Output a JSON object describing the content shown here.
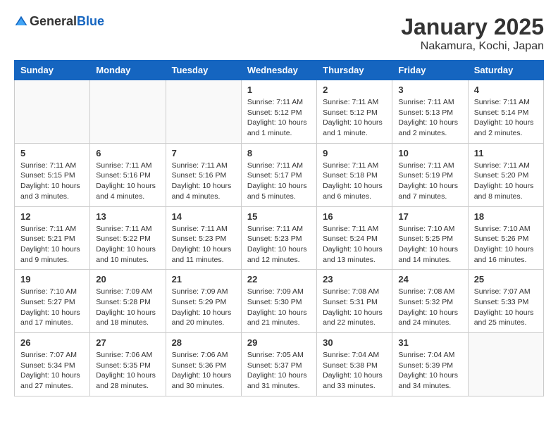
{
  "header": {
    "logo_general": "General",
    "logo_blue": "Blue",
    "title": "January 2025",
    "subtitle": "Nakamura, Kochi, Japan"
  },
  "weekdays": [
    "Sunday",
    "Monday",
    "Tuesday",
    "Wednesday",
    "Thursday",
    "Friday",
    "Saturday"
  ],
  "weeks": [
    [
      {
        "day": "",
        "info": ""
      },
      {
        "day": "",
        "info": ""
      },
      {
        "day": "",
        "info": ""
      },
      {
        "day": "1",
        "info": "Sunrise: 7:11 AM\nSunset: 5:12 PM\nDaylight: 10 hours\nand 1 minute."
      },
      {
        "day": "2",
        "info": "Sunrise: 7:11 AM\nSunset: 5:12 PM\nDaylight: 10 hours\nand 1 minute."
      },
      {
        "day": "3",
        "info": "Sunrise: 7:11 AM\nSunset: 5:13 PM\nDaylight: 10 hours\nand 2 minutes."
      },
      {
        "day": "4",
        "info": "Sunrise: 7:11 AM\nSunset: 5:14 PM\nDaylight: 10 hours\nand 2 minutes."
      }
    ],
    [
      {
        "day": "5",
        "info": "Sunrise: 7:11 AM\nSunset: 5:15 PM\nDaylight: 10 hours\nand 3 minutes."
      },
      {
        "day": "6",
        "info": "Sunrise: 7:11 AM\nSunset: 5:16 PM\nDaylight: 10 hours\nand 4 minutes."
      },
      {
        "day": "7",
        "info": "Sunrise: 7:11 AM\nSunset: 5:16 PM\nDaylight: 10 hours\nand 4 minutes."
      },
      {
        "day": "8",
        "info": "Sunrise: 7:11 AM\nSunset: 5:17 PM\nDaylight: 10 hours\nand 5 minutes."
      },
      {
        "day": "9",
        "info": "Sunrise: 7:11 AM\nSunset: 5:18 PM\nDaylight: 10 hours\nand 6 minutes."
      },
      {
        "day": "10",
        "info": "Sunrise: 7:11 AM\nSunset: 5:19 PM\nDaylight: 10 hours\nand 7 minutes."
      },
      {
        "day": "11",
        "info": "Sunrise: 7:11 AM\nSunset: 5:20 PM\nDaylight: 10 hours\nand 8 minutes."
      }
    ],
    [
      {
        "day": "12",
        "info": "Sunrise: 7:11 AM\nSunset: 5:21 PM\nDaylight: 10 hours\nand 9 minutes."
      },
      {
        "day": "13",
        "info": "Sunrise: 7:11 AM\nSunset: 5:22 PM\nDaylight: 10 hours\nand 10 minutes."
      },
      {
        "day": "14",
        "info": "Sunrise: 7:11 AM\nSunset: 5:23 PM\nDaylight: 10 hours\nand 11 minutes."
      },
      {
        "day": "15",
        "info": "Sunrise: 7:11 AM\nSunset: 5:23 PM\nDaylight: 10 hours\nand 12 minutes."
      },
      {
        "day": "16",
        "info": "Sunrise: 7:11 AM\nSunset: 5:24 PM\nDaylight: 10 hours\nand 13 minutes."
      },
      {
        "day": "17",
        "info": "Sunrise: 7:10 AM\nSunset: 5:25 PM\nDaylight: 10 hours\nand 14 minutes."
      },
      {
        "day": "18",
        "info": "Sunrise: 7:10 AM\nSunset: 5:26 PM\nDaylight: 10 hours\nand 16 minutes."
      }
    ],
    [
      {
        "day": "19",
        "info": "Sunrise: 7:10 AM\nSunset: 5:27 PM\nDaylight: 10 hours\nand 17 minutes."
      },
      {
        "day": "20",
        "info": "Sunrise: 7:09 AM\nSunset: 5:28 PM\nDaylight: 10 hours\nand 18 minutes."
      },
      {
        "day": "21",
        "info": "Sunrise: 7:09 AM\nSunset: 5:29 PM\nDaylight: 10 hours\nand 20 minutes."
      },
      {
        "day": "22",
        "info": "Sunrise: 7:09 AM\nSunset: 5:30 PM\nDaylight: 10 hours\nand 21 minutes."
      },
      {
        "day": "23",
        "info": "Sunrise: 7:08 AM\nSunset: 5:31 PM\nDaylight: 10 hours\nand 22 minutes."
      },
      {
        "day": "24",
        "info": "Sunrise: 7:08 AM\nSunset: 5:32 PM\nDaylight: 10 hours\nand 24 minutes."
      },
      {
        "day": "25",
        "info": "Sunrise: 7:07 AM\nSunset: 5:33 PM\nDaylight: 10 hours\nand 25 minutes."
      }
    ],
    [
      {
        "day": "26",
        "info": "Sunrise: 7:07 AM\nSunset: 5:34 PM\nDaylight: 10 hours\nand 27 minutes."
      },
      {
        "day": "27",
        "info": "Sunrise: 7:06 AM\nSunset: 5:35 PM\nDaylight: 10 hours\nand 28 minutes."
      },
      {
        "day": "28",
        "info": "Sunrise: 7:06 AM\nSunset: 5:36 PM\nDaylight: 10 hours\nand 30 minutes."
      },
      {
        "day": "29",
        "info": "Sunrise: 7:05 AM\nSunset: 5:37 PM\nDaylight: 10 hours\nand 31 minutes."
      },
      {
        "day": "30",
        "info": "Sunrise: 7:04 AM\nSunset: 5:38 PM\nDaylight: 10 hours\nand 33 minutes."
      },
      {
        "day": "31",
        "info": "Sunrise: 7:04 AM\nSunset: 5:39 PM\nDaylight: 10 hours\nand 34 minutes."
      },
      {
        "day": "",
        "info": ""
      }
    ]
  ]
}
